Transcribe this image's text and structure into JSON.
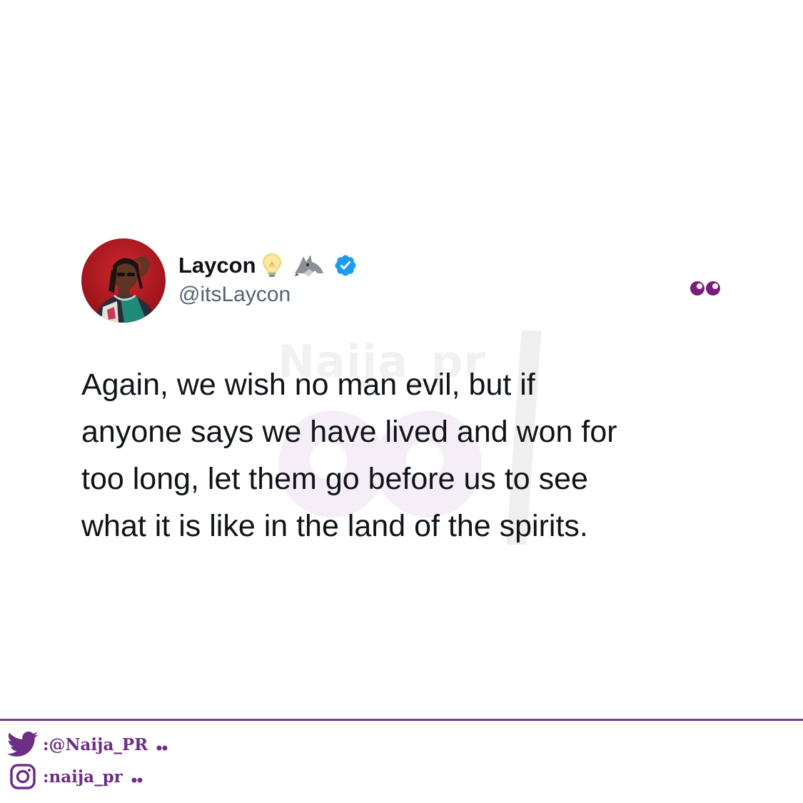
{
  "tweet": {
    "display_name": "Laycon",
    "handle": "@itsLaycon",
    "text": "Again, we wish no man evil, but if\nanyone says we have lived and won for\ntoo long, let them go before us to see\nwhat it is like in the land of the spirits.",
    "verified": true,
    "name_emojis": [
      "lightbulb-icon",
      "wolf-icon"
    ]
  },
  "watermark": {
    "text": "Naija_pr"
  },
  "footer": {
    "twitter_handle": ":@Naija_PR",
    "instagram_handle": ":naija_pr"
  },
  "colors": {
    "brand_purple": "#7b3a93",
    "verified_blue": "#1d9bf0",
    "handle_gray": "#536471",
    "text": "#0f1419"
  }
}
